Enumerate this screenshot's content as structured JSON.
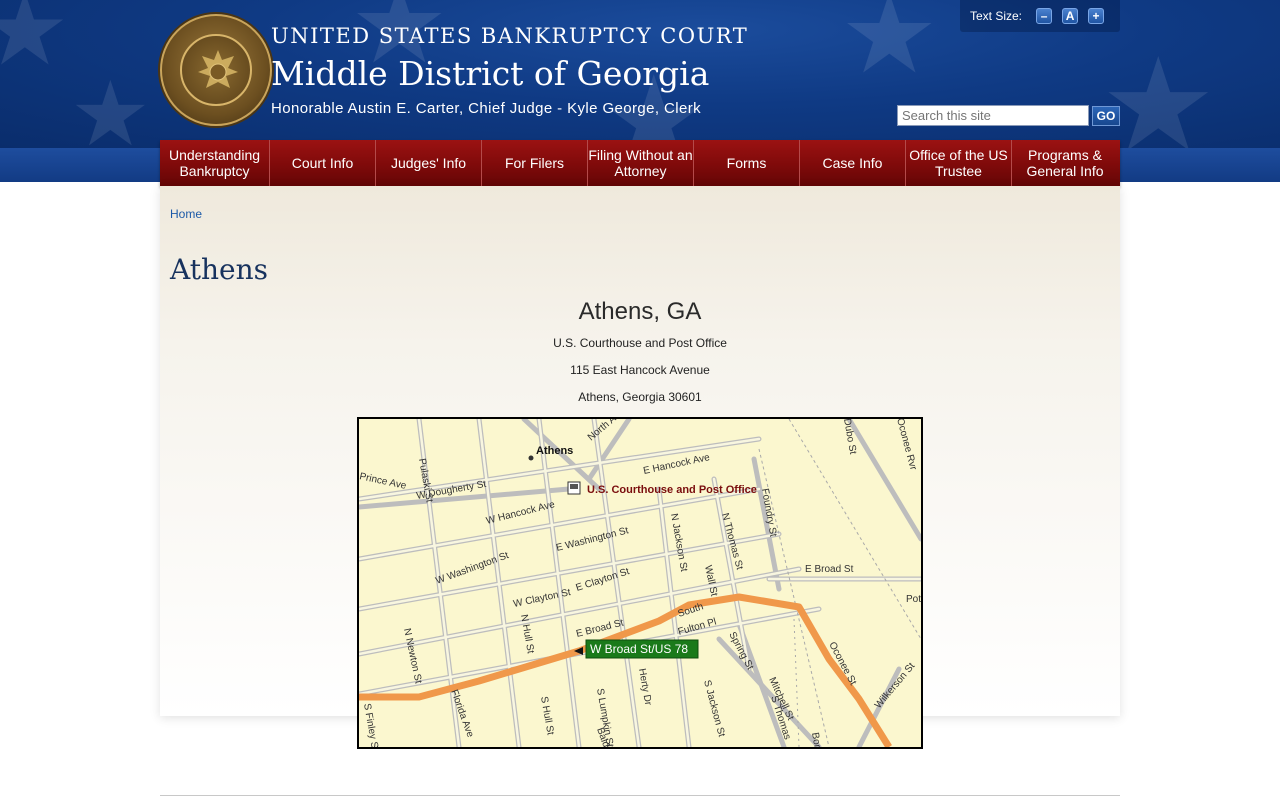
{
  "header": {
    "court_line": "UNITED STATES BANKRUPTCY COURT",
    "district": "Middle District of Georgia",
    "judge_line": "Honorable Austin E. Carter, Chief Judge - Kyle George, Clerk",
    "seal_icon": "court-seal-icon"
  },
  "text_size": {
    "label": "Text Size:",
    "decrease": "–",
    "reset": "A",
    "increase": "+"
  },
  "search": {
    "placeholder": "Search this site",
    "go_label": "GO"
  },
  "nav": {
    "items": [
      "Understanding Bankruptcy",
      "Court Info",
      "Judges' Info",
      "For Filers",
      "Filing Without an Attorney",
      "Forms",
      "Case Info",
      "Office of the US Trustee",
      "Programs & General Info"
    ]
  },
  "breadcrumb": {
    "home": "Home"
  },
  "page": {
    "title": "Athens",
    "city": "Athens, GA",
    "address": [
      "U.S. Courthouse and Post Office",
      "115 East Hancock Avenue",
      "Athens, Georgia 30601"
    ]
  },
  "map": {
    "place_label": "Athens",
    "marker_label": "U.S. Courthouse and Post Office",
    "route_label": "W Broad St/US 78",
    "streets": [
      "Pulaski St",
      "Prince Ave",
      "W Dougherty St",
      "E Hancock Ave",
      "North Ave",
      "W Hancock Ave",
      "E Washington St",
      "W Washington St",
      "N Jackson St",
      "N Thomas St",
      "Foundry St",
      "E Broad St",
      "W Clayton St",
      "E Clayton St",
      "E Broad St",
      "Wall St",
      "South",
      "Fulton Pl",
      "Spring St",
      "Oconee St",
      "Wilkerson St",
      "N Newton St",
      "N Hull St",
      "Florida Ave",
      "S Hull St",
      "S Lumpkin St",
      "Herty Dr",
      "S Jackson St",
      "Mitchell St",
      "S Thomas",
      "S Finley St",
      "Oconee Rvr",
      "Pot",
      "Bon",
      "Bald",
      "Dubo St"
    ],
    "colors": {
      "background": "#fbf7cf",
      "road": "#c8c8c8",
      "route": "#f0984a",
      "label_box": "#1a7a1a"
    }
  }
}
